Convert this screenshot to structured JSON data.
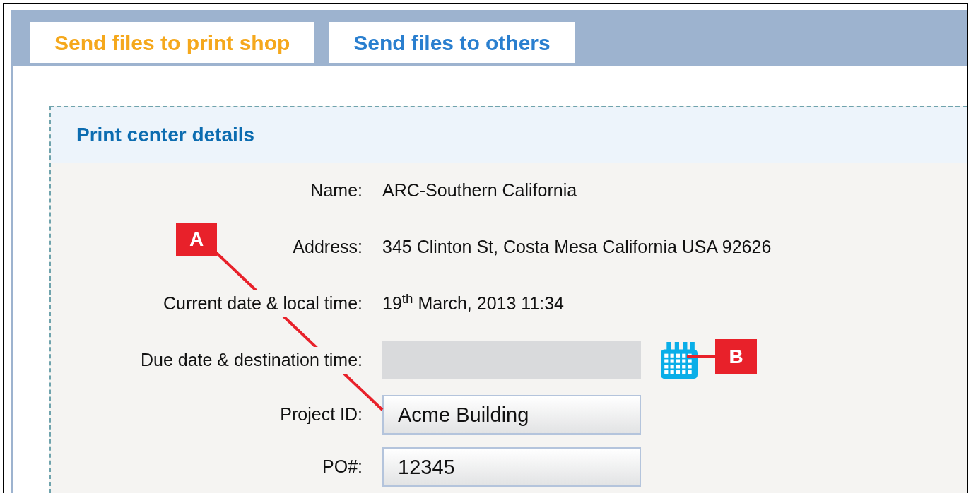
{
  "tabs": [
    {
      "label": "Send files to print shop",
      "selected": true
    },
    {
      "label": "Send files to others",
      "selected": false
    }
  ],
  "panel": {
    "title": "Print center details",
    "rows": [
      {
        "kind": "text",
        "label": "Name:",
        "value": "ARC-Southern California"
      },
      {
        "kind": "text",
        "label": "Address:",
        "value": "345 Clinton St, Costa Mesa California USA 92626"
      },
      {
        "kind": "text",
        "label": "Current date & local time:",
        "value": "19$^{th}$ March, 2013 11:34"
      },
      {
        "kind": "date",
        "label": "Due date & destination time:"
      },
      {
        "kind": "input",
        "label": "Project ID:",
        "value": "Acme Building"
      },
      {
        "kind": "input",
        "label": "PO#:",
        "value": "12345"
      }
    ]
  },
  "callouts": [
    {
      "label": "A"
    },
    {
      "label": "B"
    }
  ]
}
